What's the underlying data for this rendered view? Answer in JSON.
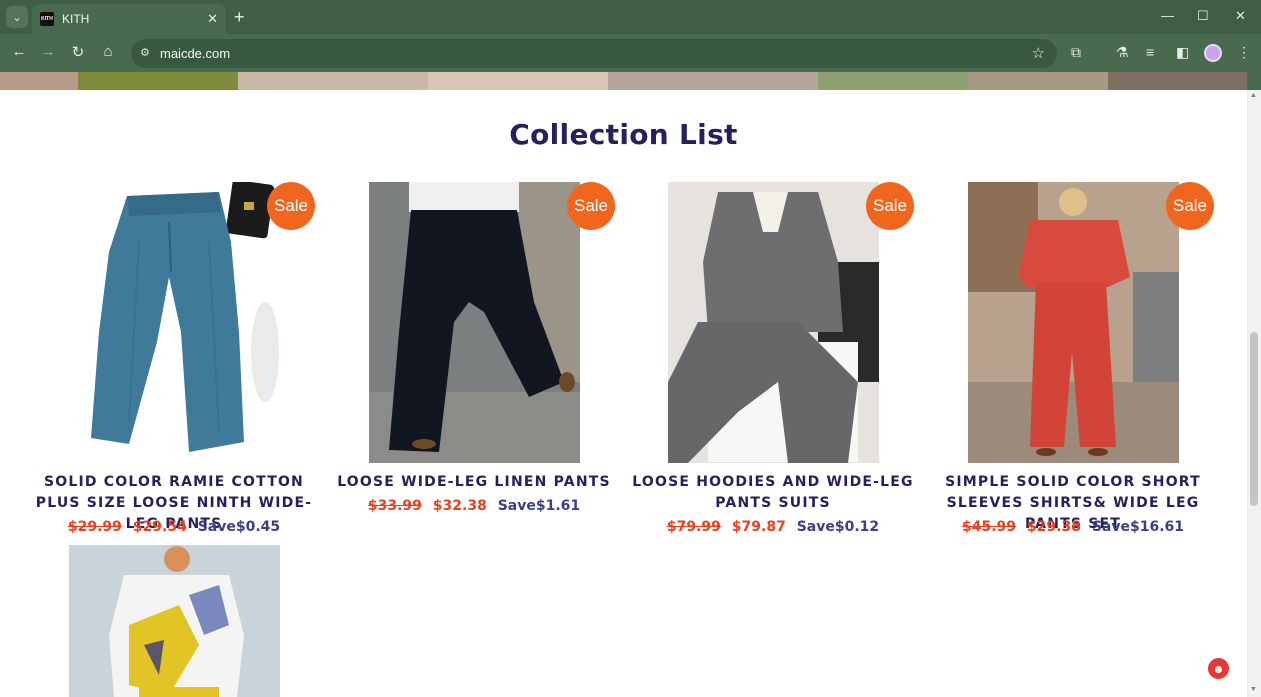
{
  "browser": {
    "tab_title": "KITH",
    "tab_favicon_text": "KITH",
    "url": "maicde.com",
    "icons": [
      "tab-search-icon",
      "close-icon",
      "plus-icon",
      "minimize-icon",
      "maximize-icon",
      "close-window-icon",
      "back-arrow-icon",
      "forward-arrow-icon",
      "reload-icon",
      "home-icon",
      "site-settings-icon",
      "star-icon",
      "extensions-icon",
      "labs-icon",
      "media-icon",
      "sidebar-icon",
      "profile-avatar",
      "kebab-menu-icon"
    ]
  },
  "section": {
    "title": "Collection List"
  },
  "sale_badge": "Sale",
  "products": [
    {
      "name": "SOLID COLOR RAMIE COTTON PLUS SIZE LOOSE NINTH WIDE-LEG PANTS",
      "old_price": "$29.99",
      "price": "$29.54",
      "save": "Save$0.45",
      "image": "blue-wide-leg-pants"
    },
    {
      "name": "LOOSE WIDE-LEG LINEN PANTS",
      "old_price": "$33.99",
      "price": "$32.38",
      "save": "Save$1.61",
      "image": "black-wide-leg-pants"
    },
    {
      "name": "LOOSE HOODIES AND WIDE-LEG PANTS SUITS",
      "old_price": "$79.99",
      "price": "$79.87",
      "save": "Save$0.12",
      "image": "grey-hoodie-suit"
    },
    {
      "name": "SIMPLE SOLID COLOR SHORT SLEEVES SHIRTS& WIDE LEG PANTS SET",
      "old_price": "$45.99",
      "price": "$29.38",
      "save": "Save$16.61",
      "image": "red-short-sleeve-set"
    },
    {
      "name": "",
      "image": "white-yellow-print-shirt"
    }
  ],
  "colors": {
    "brand_navy": "#25215e",
    "sale_orange": "#f1661e",
    "price_red": "#e8411f",
    "save_blue": "#3b3f88",
    "chrome_green": "#4a6a4f"
  }
}
